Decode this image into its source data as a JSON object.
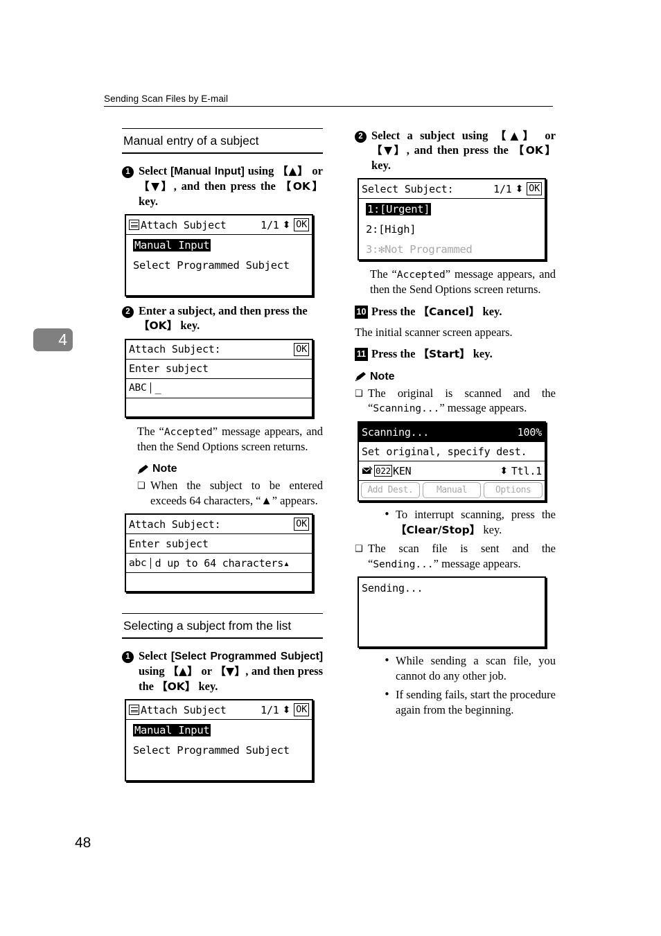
{
  "page": {
    "running_header": "Sending Scan Files by E-mail",
    "chapter_tab": "4",
    "page_number": "48"
  },
  "left_column": {
    "section1_heading": "Manual entry of a subject",
    "step1": {
      "marker": "1",
      "text_parts": [
        "Select ",
        "[Manual Input]",
        " using ",
        "【▲】",
        " or ",
        "【▼】",
        ", and then press the ",
        "【OK】",
        " key."
      ]
    },
    "screen_attach_subject_1": {
      "icon": "menu-list-icon",
      "title": "Attach Subject",
      "page_indicator": "1/1",
      "updown": "⬍",
      "ok": "OK",
      "item_selected": "Manual Input",
      "item_2": "Select Programmed Subject"
    },
    "step2": {
      "marker": "2",
      "text_parts": [
        "Enter a subject, and then press the ",
        "【OK】",
        " key."
      ]
    },
    "screen_enter_subject_empty": {
      "title": "Attach Subject:",
      "ok": "OK",
      "prompt": "Enter subject",
      "mode": "ABC",
      "value": "_"
    },
    "accepted_paragraph": {
      "before": "The “",
      "mono": "Accepted",
      "after": "” message appears, and then the Send Options screen returns."
    },
    "note_label": "Note",
    "note_item_64chars": "When the subject to be entered exceeds 64 characters, “▲” appears.",
    "screen_enter_subject_filled": {
      "title": "Attach Subject:",
      "ok": "OK",
      "prompt": "Enter subject",
      "mode": "abc",
      "value": "d up to 64 characters",
      "overflow_caret": "▴"
    },
    "section2_heading": "Selecting a subject from the list",
    "step1b": {
      "marker": "1",
      "text_parts": [
        "Select ",
        "[Select Programmed Subject]",
        " using ",
        "【▲】",
        " or ",
        "【▼】",
        ", and then press the ",
        "【OK】",
        " key."
      ]
    },
    "screen_attach_subject_2": {
      "icon": "menu-list-icon",
      "title": "Attach Subject",
      "page_indicator": "1/1",
      "updown": "⬍",
      "ok": "OK",
      "item_selected": "Manual Input",
      "item_2": "Select Programmed Subject"
    }
  },
  "right_column": {
    "step2": {
      "marker": "2",
      "text_parts": [
        "Select a subject using ",
        "【▲】",
        " or ",
        "【▼】",
        ", and then press the ",
        "【OK】",
        " key."
      ]
    },
    "screen_select_subject": {
      "title": "Select Subject:",
      "page_indicator": "1/1",
      "updown": "⬍",
      "ok": "OK",
      "item_1": "1:[Urgent]",
      "item_2": "2:[High]",
      "item_3": "3:✻Not Programmed",
      "item_3_disabled": true
    },
    "accepted_paragraph": {
      "before": "The “",
      "mono": "Accepted",
      "after": "” message appears, and then the Send Options screen returns."
    },
    "step10": {
      "marker": "10",
      "text_parts": [
        "Press the ",
        "【Cancel】",
        " key."
      ],
      "follow_text": "The initial scanner screen appears."
    },
    "step11": {
      "marker": "11",
      "text_parts": [
        "Press the ",
        "【Start】",
        " key."
      ]
    },
    "note_label": "Note",
    "note_item_scanning": {
      "before": "The original is scanned and the “",
      "mono": "Scanning...",
      "after": "” message appears."
    },
    "screen_scanning": {
      "title": "Scanning...",
      "percent": "100%",
      "line2": "Set original, specify dest.",
      "dest_icon": "envelope-icon",
      "count": "022",
      "dest_name": "KEN",
      "updown": "⬍",
      "total": "Ttl.1",
      "buttons": [
        "Add Dest.",
        "Manual",
        "Options"
      ],
      "buttons_disabled": true
    },
    "bullet_interrupt": {
      "before": "To interrupt scanning, press the ",
      "key": "【Clear/Stop】",
      "after": " key."
    },
    "note_item_sending": {
      "before": "The scan file is sent and the “",
      "mono": "Sending...",
      "after": "” message appears."
    },
    "screen_sending": {
      "title": "Sending..."
    },
    "bullet_while_sending": "While sending a scan file, you cannot do any other job.",
    "bullet_if_fails": "If sending fails, start the procedure again from the beginning."
  }
}
